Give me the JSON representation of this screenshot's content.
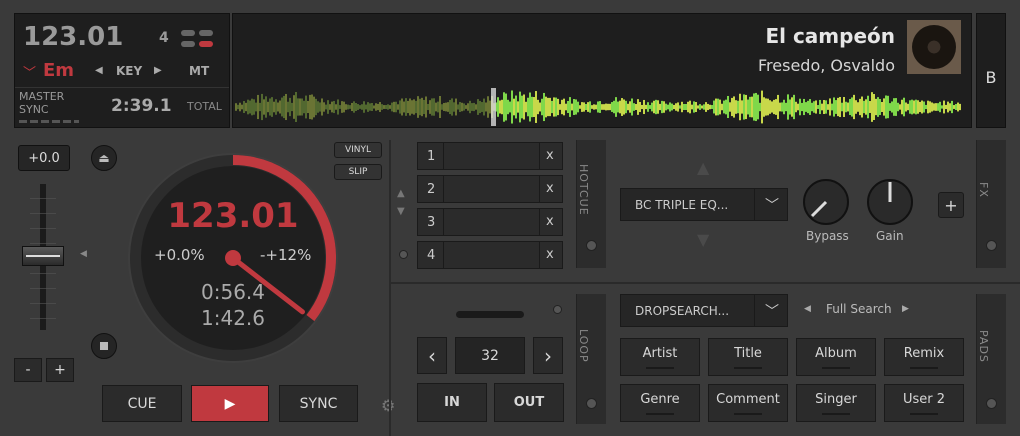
{
  "deck": {
    "bpm": "123.01",
    "beat_count": "4",
    "key": "Em",
    "key_label": "KEY",
    "mt_label": "MT",
    "master_label": "MASTER",
    "sync_label": "SYNC",
    "total_time": "2:39.1",
    "total_label": "TOTAL",
    "side_label": "B"
  },
  "track": {
    "title": "El campeón",
    "artist": "Fresedo, Osvaldo"
  },
  "pitch": {
    "value": "+0.0",
    "minus": "-",
    "plus": "+"
  },
  "jog": {
    "bpm": "123.01",
    "pitch_pct": "+0.0%",
    "range": "-+12%",
    "elapsed": "0:56.4",
    "remain": "1:42.6",
    "vinyl_label": "VINYL",
    "slip_label": "SLIP",
    "progress": 0.355
  },
  "transport": {
    "cue": "CUE",
    "play": "▶",
    "sync": "SYNC"
  },
  "hotcues": {
    "label": "HOTCUE",
    "slots": [
      {
        "num": "1",
        "x": "x"
      },
      {
        "num": "2",
        "x": "x"
      },
      {
        "num": "3",
        "x": "x"
      },
      {
        "num": "4",
        "x": "x"
      }
    ]
  },
  "fx": {
    "effect_name": "BC TRIPLE EQ...",
    "knob1": "Bypass",
    "knob2": "Gain",
    "add": "+",
    "label": "FX"
  },
  "loop": {
    "label": "LOOP",
    "size": "32",
    "prev": "‹",
    "next": "›",
    "in": "IN",
    "out": "OUT"
  },
  "pads": {
    "label": "PADS",
    "dropdown": "DROPSEARCH...",
    "search_mode": "Full Search",
    "buttons": [
      "Artist",
      "Title",
      "Album",
      "Remix",
      "Genre",
      "Comment",
      "Singer",
      "User 2"
    ]
  },
  "colors": {
    "accent_red": "#c0393f",
    "waveform_green": "#7fd84a"
  }
}
